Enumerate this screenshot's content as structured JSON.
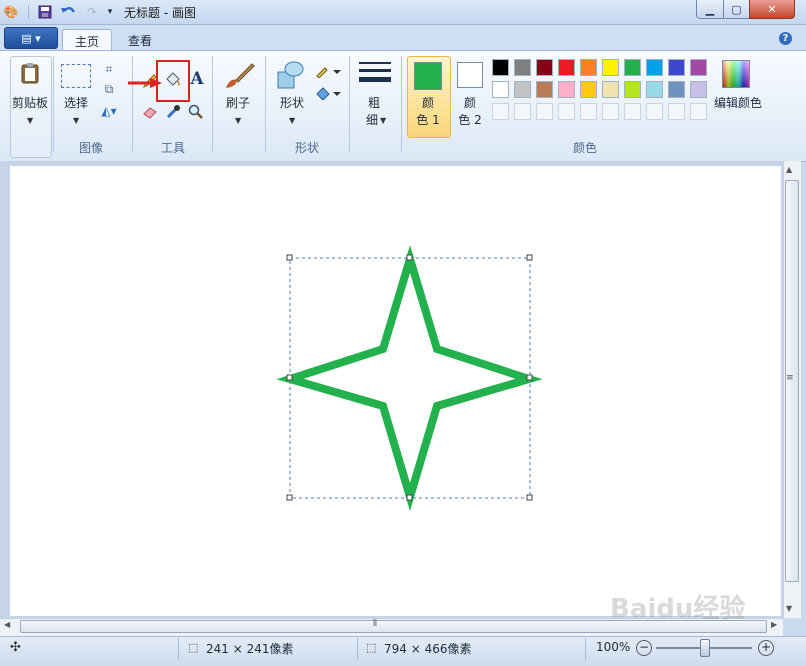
{
  "window": {
    "title": "无标题 - 画图"
  },
  "tabs": [
    {
      "label": "主页"
    },
    {
      "label": "查看"
    }
  ],
  "ribbon": {
    "clipboard": {
      "label": "剪贴板"
    },
    "image": {
      "select_label": "选择",
      "group_label": "图像"
    },
    "tools": {
      "group_label": "工具",
      "text_tool": "A"
    },
    "brushes": {
      "label": "刷子"
    },
    "shapes": {
      "label": "形状",
      "group_label": "形状"
    },
    "size": {
      "label_1": "粗",
      "label_2": "细"
    },
    "colors": {
      "color1_label_1": "颜",
      "color1_label_2": "色 1",
      "color2_label_1": "颜",
      "color2_label_2": "色 2",
      "edit_label": "编辑颜色",
      "group_label": "颜色",
      "color1": "#22b14c",
      "color2": "#ffffff",
      "palette_row1": [
        "#000000",
        "#7f7f7f",
        "#880015",
        "#ed1c24",
        "#ff7f27",
        "#fff200",
        "#22b14c",
        "#00a2e8",
        "#3f48cc",
        "#a349a4"
      ],
      "palette_row2": [
        "#ffffff",
        "#c3c3c3",
        "#b97a57",
        "#ffaec9",
        "#ffc90e",
        "#efe4b0",
        "#b5e61d",
        "#99d9ea",
        "#7092be",
        "#c8bfe7"
      ]
    }
  },
  "canvas": {
    "shape_color": "#22b14c"
  },
  "status": {
    "selection_size": "241 × 241像素",
    "image_size": "794 × 466像素",
    "zoom": "100%"
  },
  "watermark": "Baidu经验"
}
